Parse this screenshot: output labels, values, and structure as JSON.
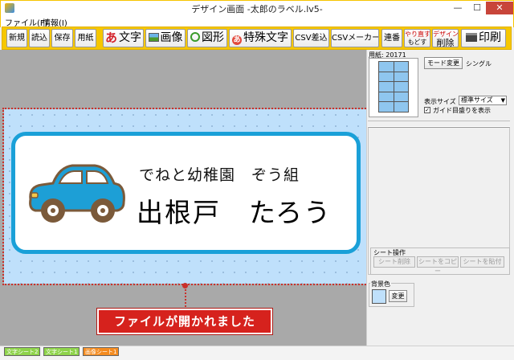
{
  "window": {
    "title": "デザイン画面 -太郎のラベル.lv5-",
    "minimize": "—",
    "maximize": "☐",
    "close": "✕"
  },
  "menu": {
    "items": [
      "ファイル(F)",
      "情報(I)"
    ]
  },
  "toolbar": {
    "new": "新規",
    "open": "読込",
    "save": "保存",
    "paper": "用紙",
    "text": "文字",
    "text_icon": "あ",
    "image": "画像",
    "shape": "図形",
    "special": "特殊文字",
    "special_icon": "あ",
    "csv_insert": "CSV差込",
    "csv_maker": "CSVメーカー",
    "serial": "連番",
    "undo": "やり直す",
    "redo": "もどす",
    "design": "デザイン",
    "delete": "削除",
    "print": "印刷"
  },
  "label": {
    "kindergarten": "でねと幼稚園　ぞう組",
    "name": "出根戸　たろう"
  },
  "callout": {
    "message": "ファイルが開かれました"
  },
  "right_panel": {
    "paper_number": "用紙: 20171",
    "mode_change": "モード変更",
    "mode_value": "シングル",
    "display_size_label": "表示サイズ",
    "display_size_value": "標準サイズ",
    "display_size_arrow": "▼",
    "guide_check": "✓",
    "guide_label": "ガイド目盛りを表示",
    "sheet_ops": {
      "title": "シート操作",
      "delete": "シート削除",
      "copy": "シートをコピー",
      "paste": "シートを貼付"
    },
    "background": {
      "title": "背景色",
      "change": "変更"
    }
  },
  "sheet_tabs": [
    {
      "label": "文字シート2",
      "color": "#8ed34a"
    },
    {
      "label": "文字シート1",
      "color": "#8ed34a"
    },
    {
      "label": "画像シート1",
      "color": "#f48b1f"
    }
  ],
  "colors": {
    "toolbar": "#f6c700",
    "label_border": "#1aa0d8",
    "sheet_bg": "#bfe0fb",
    "callout": "#d6221d",
    "car_body": "#1d9fd6"
  }
}
